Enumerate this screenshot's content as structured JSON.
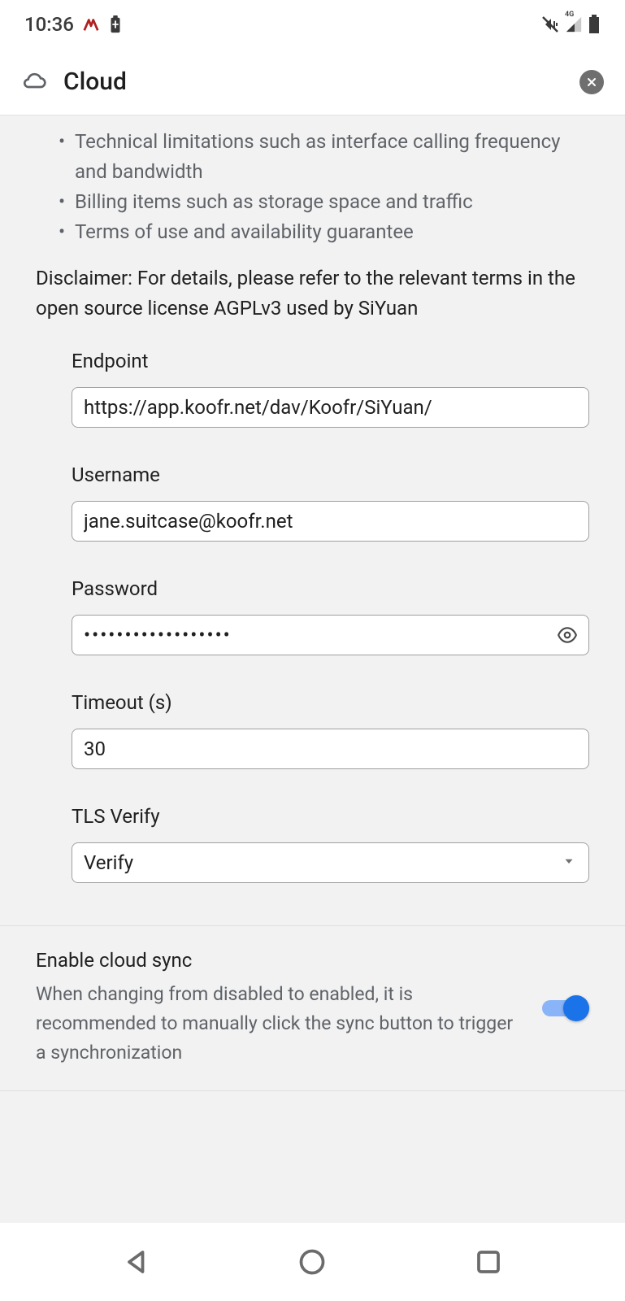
{
  "status": {
    "time": "10:36",
    "network_label": "4G"
  },
  "header": {
    "title": "Cloud"
  },
  "info": {
    "bullets": [
      "Technical limitations such as interface calling frequency and bandwidth",
      "Billing items such as storage space and traffic",
      "Terms of use and availability guarantee"
    ],
    "disclaimer": "Disclaimer: For details, please refer to the relevant terms in the open source license AGPLv3 used by SiYuan"
  },
  "form": {
    "endpoint": {
      "label": "Endpoint",
      "value": "https://app.koofr.net/dav/Koofr/SiYuan/"
    },
    "username": {
      "label": "Username",
      "value": "jane.suitcase@koofr.net"
    },
    "password": {
      "label": "Password",
      "value": "••••••••••••••••••"
    },
    "timeout": {
      "label": "Timeout (s)",
      "value": "30"
    },
    "tls": {
      "label": "TLS Verify",
      "value": "Verify"
    }
  },
  "sync": {
    "title": "Enable cloud sync",
    "description": "When changing from disabled to enabled, it is recommended to manually click the sync button to trigger a synchronization",
    "enabled": true
  }
}
